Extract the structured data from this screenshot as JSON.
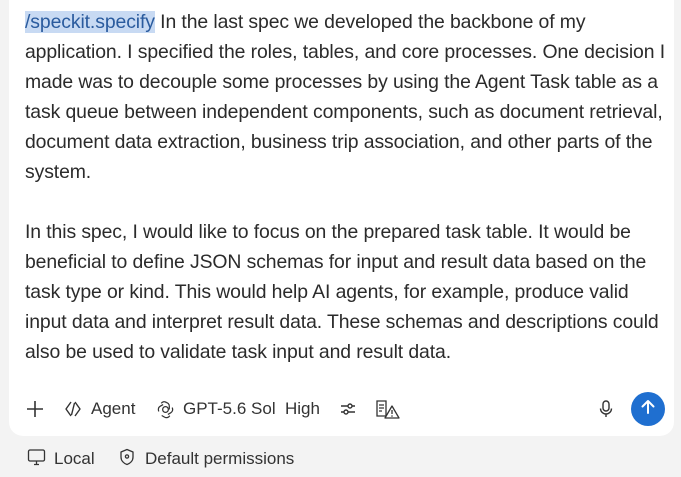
{
  "prompt": {
    "command": "/speckit.specify",
    "paragraph1_rest": " In the last spec we developed the backbone of my application. I specified the roles, tables, and core processes. One decision I made was to decouple some processes by using the Agent Task table as a task queue between independent components, such as document retrieval, document data extraction, business trip association, and other parts of the system.",
    "paragraph2": "In this spec, I would like to focus on the prepared task table. It would be beneficial to define JSON schemas for input and result data based on the task type or kind. This would help AI agents, for example, produce valid input data and interpret result data. These schemas and descriptions could also be used to validate task input and result data."
  },
  "toolbar": {
    "add_icon": "plus-icon",
    "mode_label": "Agent",
    "mode_icon": "agent-icon",
    "model_label": "GPT-5.6 Sol",
    "model_icon": "openai-icon",
    "effort_label": "High",
    "settings_icon": "sliders-icon",
    "review_icon": "document-warning-icon",
    "mic_icon": "microphone-icon",
    "send_icon": "arrow-up-icon"
  },
  "footer": {
    "location_label": "Local",
    "location_icon": "monitor-icon",
    "permissions_label": "Default permissions",
    "permissions_icon": "shield-icon"
  },
  "colors": {
    "send_button": "#1f6fd0",
    "command_highlight": "#c8daf3",
    "command_text": "#2a5b9e"
  }
}
